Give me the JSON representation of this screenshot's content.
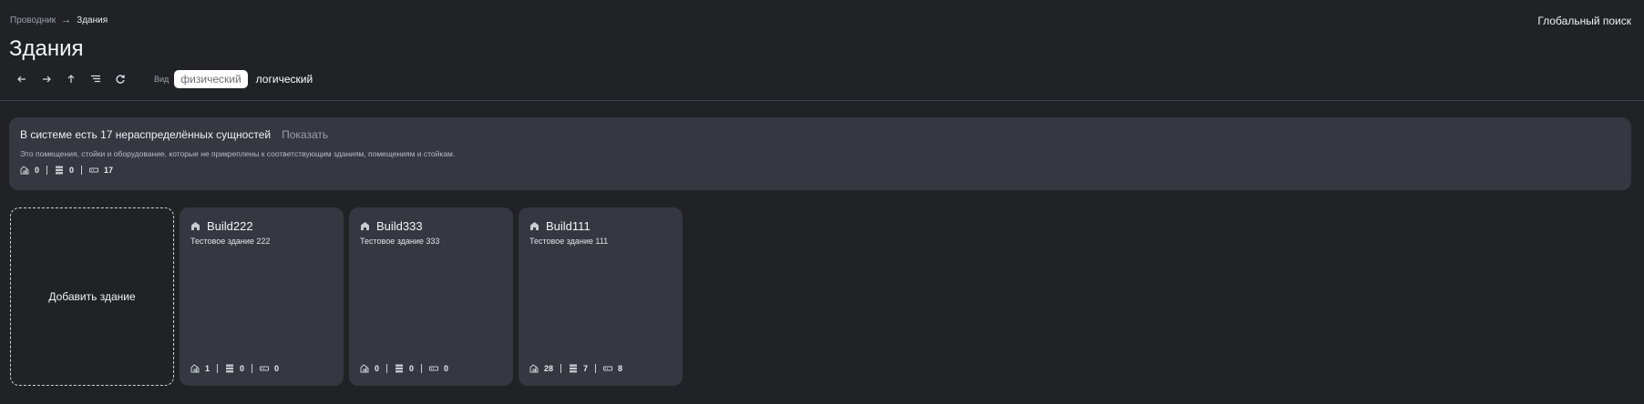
{
  "breadcrumb": {
    "root": "Проводник",
    "separator": "→",
    "current": "Здания"
  },
  "header": {
    "global_search": "Глобальный поиск",
    "title": "Здания"
  },
  "toolbar": {
    "buttons": [
      "arrow-left-icon",
      "arrow-right-icon",
      "arrow-up-icon",
      "tree-view-icon",
      "refresh-icon"
    ],
    "view_label": "Вид",
    "view_options": [
      "физический",
      "логический"
    ],
    "view_selected": "физический"
  },
  "banner": {
    "title": "В системе есть 17 нераспределённых сущностей",
    "action": "Показать",
    "description": "Это помещения, стойки и оборудование, которые не прикреплены к соответствующим зданиям, помещениям и стойкам.",
    "stats": {
      "rooms": "0",
      "racks": "0",
      "devices": "17"
    }
  },
  "add_building": "Добавить здание",
  "buildings": [
    {
      "name": "Build222",
      "description": "Тестовое здание 222",
      "stats": {
        "rooms": "1",
        "racks": "0",
        "devices": "0"
      }
    },
    {
      "name": "Build333",
      "description": "Тестовое здание 333",
      "stats": {
        "rooms": "0",
        "racks": "0",
        "devices": "0"
      }
    },
    {
      "name": "Build111",
      "description": "Тестовое здание 111",
      "stats": {
        "rooms": "28",
        "racks": "7",
        "devices": "8"
      }
    }
  ],
  "colors": {
    "background": "#202226",
    "card": "#353840",
    "text": "#e9ebee",
    "muted": "#9aa0a8"
  }
}
